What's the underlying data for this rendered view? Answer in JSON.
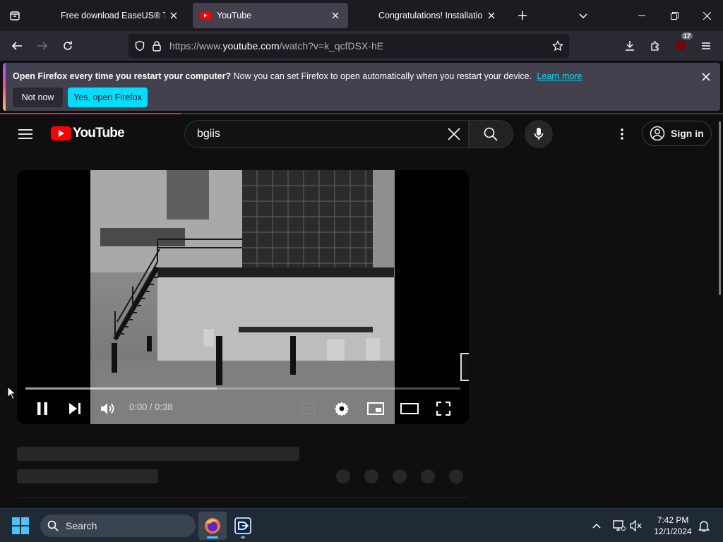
{
  "browser": {
    "tabs": [
      {
        "title": "Free download EaseUS® Todo",
        "active": false
      },
      {
        "title": "YouTube",
        "active": true
      },
      {
        "title": "Congratulations! Installation of",
        "active": false
      }
    ],
    "address": {
      "prefix": "https://www.",
      "host": "youtube.com",
      "path": "/watch?v=k_qcfDSX-hE"
    },
    "extension_badge": "17"
  },
  "notification": {
    "bold": "Open Firefox every time you restart your computer?",
    "text": "Now you can set Firefox to open automatically when you restart your device.",
    "link": "Learn more",
    "not_now": "Not now",
    "yes": "Yes, open Firefox"
  },
  "youtube": {
    "logo_text": "YouTube",
    "search_query": "bgiis",
    "sign_in": "Sign in"
  },
  "player": {
    "time": "0:00 / 0:38",
    "buffered_fraction": 0.44,
    "state": "playing"
  },
  "taskbar": {
    "search_label": "Search",
    "time": "7:42 PM",
    "date": "12/1/2024"
  },
  "colors": {
    "accent_firefox": "#00ddff",
    "youtube_red": "#ff0000",
    "load_bar": "#e0245e"
  }
}
